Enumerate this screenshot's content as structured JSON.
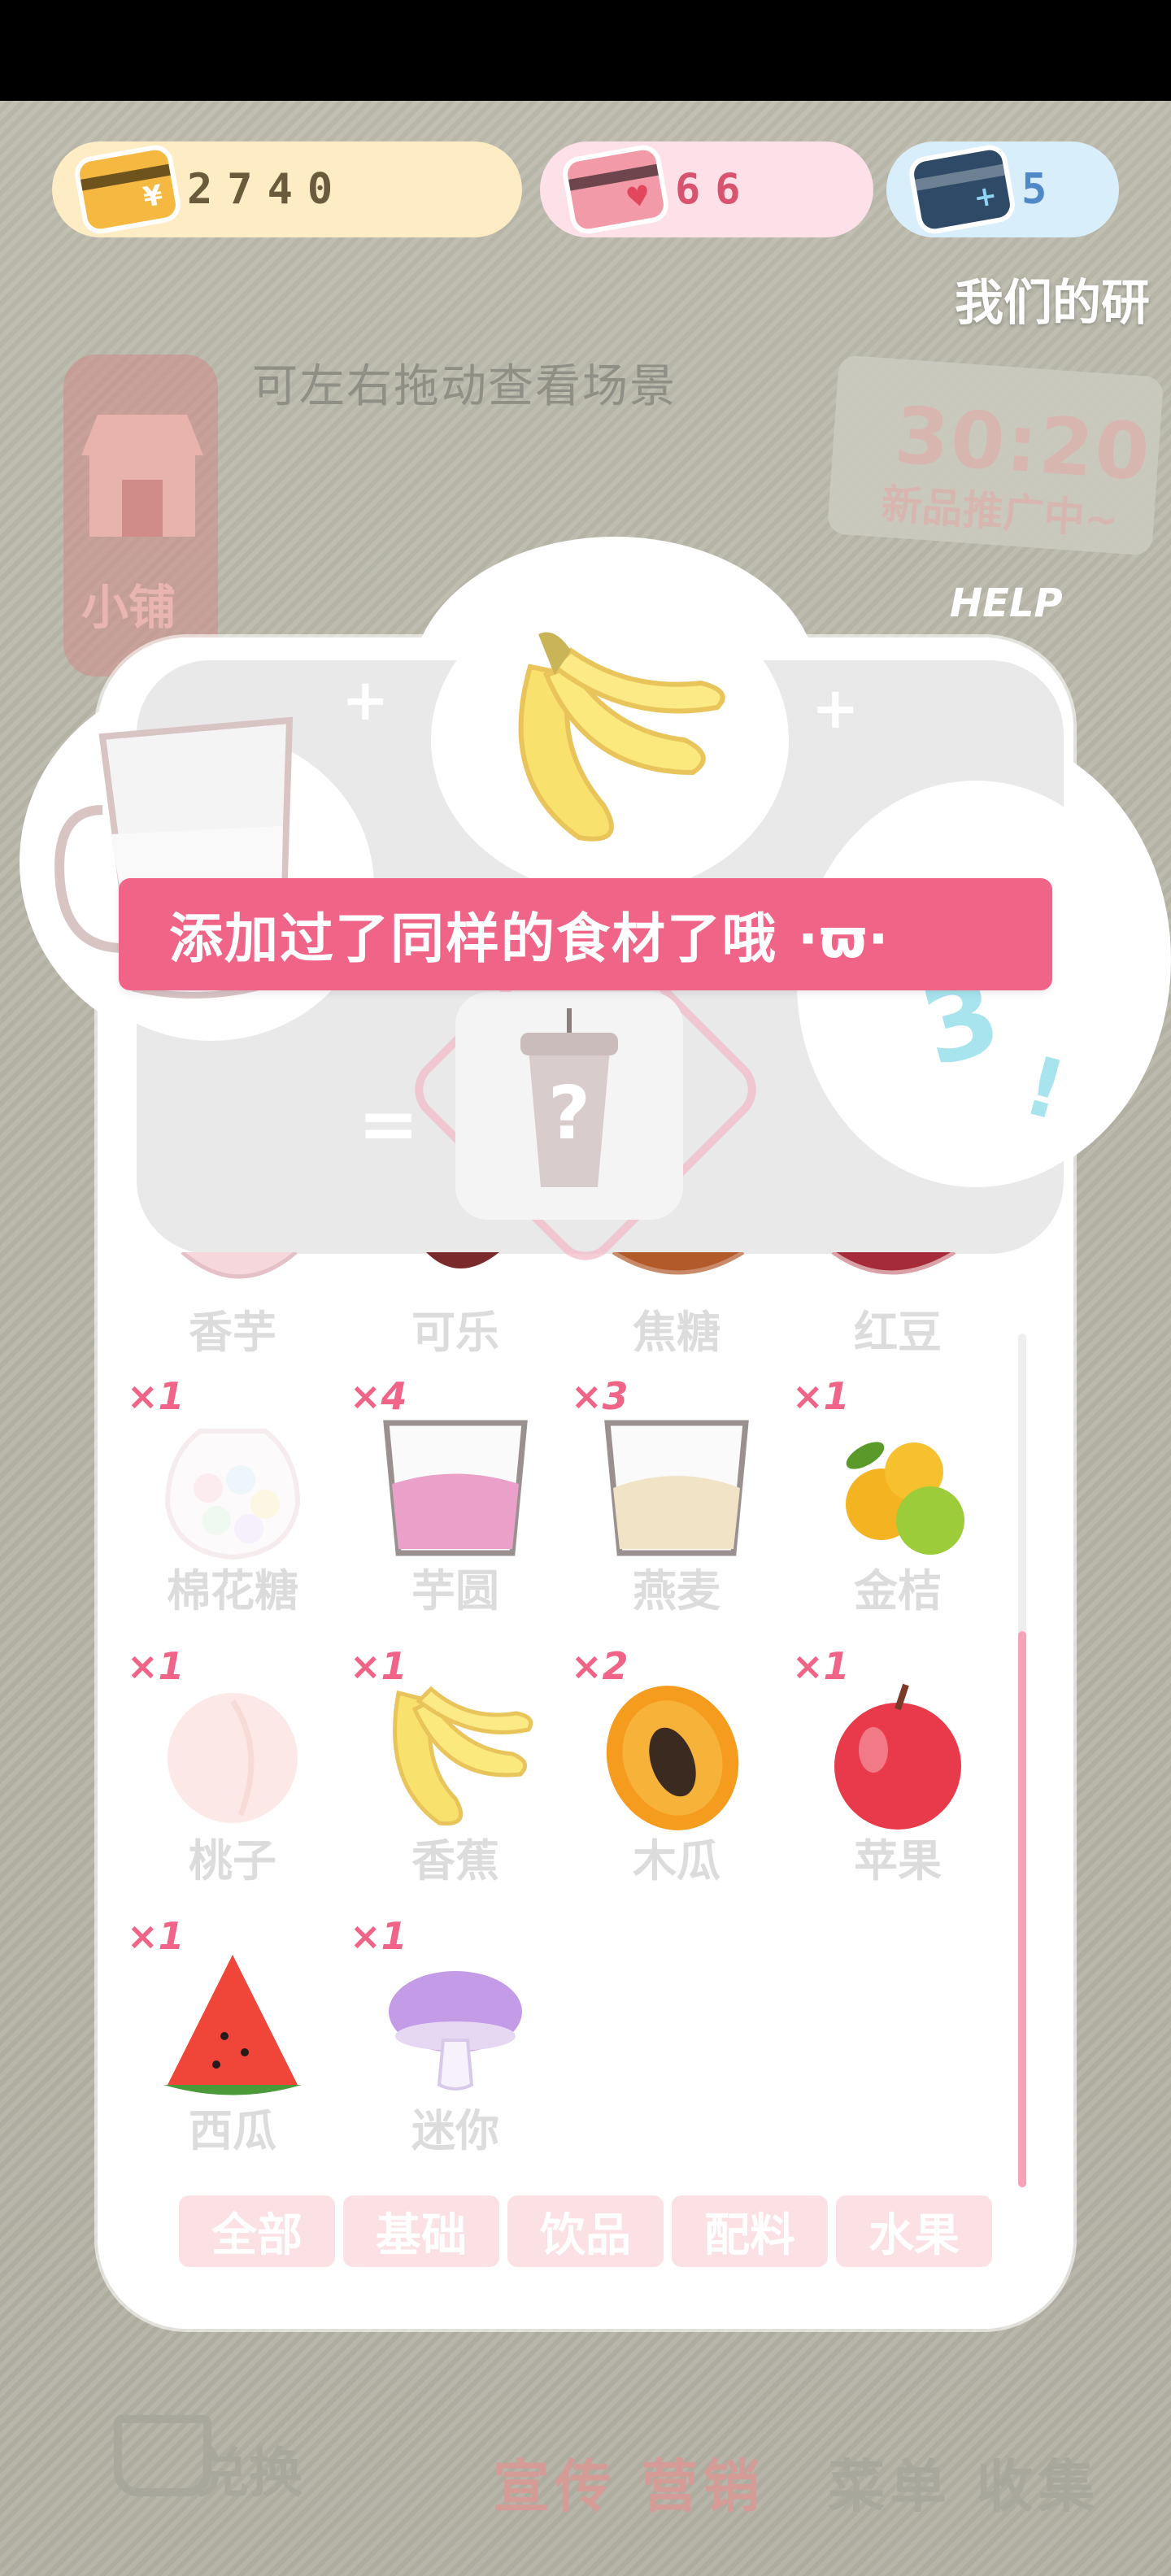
{
  "currencies": [
    {
      "name": "coins",
      "value": "2740",
      "color": "#fdecc4",
      "text_color": "#6a5b3d",
      "icon": "gold-card-icon"
    },
    {
      "name": "hearts",
      "value": "66",
      "color": "#fde0e8",
      "text_color": "#d8546e",
      "icon": "heart-card-icon"
    },
    {
      "name": "tickets",
      "value": "5",
      "color": "#d9eefb",
      "text_color": "#4f88c6",
      "icon": "blue-card-icon"
    }
  ],
  "header": {
    "title": "我们的研"
  },
  "scene": {
    "hint": "可左右拖动查看场景",
    "shop_label": "小铺",
    "promo_time": "30:20",
    "promo_sub": "新品推广中~",
    "help": "HELP"
  },
  "toast": {
    "message": "添加过了同样的食材了哦 ·ϖ·"
  },
  "recipe": {
    "slot1": "cup-icon",
    "slot2": "banana-icon",
    "result": "mystery-drink-icon",
    "mark": "3"
  },
  "ingredients_top": [
    "香芋",
    "可乐",
    "焦糖",
    "红豆"
  ],
  "ingredients": [
    {
      "count": "×1",
      "name": "棉花糖",
      "icon": "marshmallow-icon",
      "faded": true
    },
    {
      "count": "×4",
      "name": "芋圆",
      "icon": "taro-ball-cup-icon",
      "faded": false
    },
    {
      "count": "×3",
      "name": "燕麦",
      "icon": "oat-cup-icon",
      "faded": false
    },
    {
      "count": "×1",
      "name": "金桔",
      "icon": "kumquat-icon",
      "faded": false
    },
    {
      "count": "×1",
      "name": "桃子",
      "icon": "peach-icon",
      "faded": true
    },
    {
      "count": "×1",
      "name": "香蕉",
      "icon": "banana-icon",
      "faded": false
    },
    {
      "count": "×2",
      "name": "木瓜",
      "icon": "papaya-icon",
      "faded": false
    },
    {
      "count": "×1",
      "name": "苹果",
      "icon": "apple-icon",
      "faded": false
    },
    {
      "count": "×1",
      "name": "西瓜",
      "icon": "watermelon-icon",
      "faded": false
    },
    {
      "count": "×1",
      "name": "迷你",
      "icon": "mini-mushroom-icon",
      "faded": false
    }
  ],
  "tabs": [
    "全部",
    "基础",
    "饮品",
    "配料",
    "水果"
  ],
  "bottom_nav": {
    "exchange": "兑换",
    "promote": "宣传 营销",
    "menu": "菜单 收集"
  }
}
